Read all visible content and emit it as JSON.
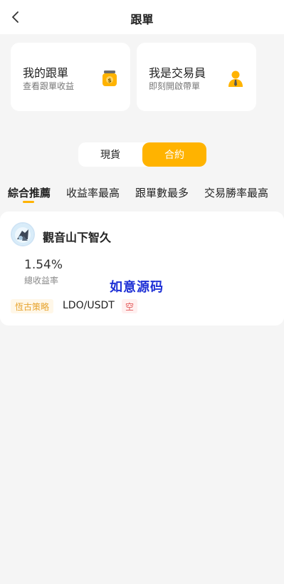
{
  "header": {
    "title": "跟單"
  },
  "cards": {
    "left": {
      "title": "我的跟單",
      "subtitle": "查看跟單收益"
    },
    "right": {
      "title": "我是交易員",
      "subtitle": "即刻開啟帶單"
    }
  },
  "segment": {
    "options": [
      "現貨",
      "合約"
    ],
    "selected": "合約"
  },
  "tabs": [
    "綜合推薦",
    "收益率最高",
    "跟單數最多",
    "交易勝率最高"
  ],
  "active_tab": "綜合推薦",
  "trader": {
    "name": "觀音山下智久",
    "yield_value": "1.54%",
    "yield_label": "總收益率",
    "strategy_tag": "恆古策略",
    "pair": "LDO/USDT",
    "direction_tag": "空"
  },
  "watermark": "如意源码",
  "colors": {
    "accent": "#ffb300",
    "background": "#f5f5f5",
    "short_red": "#e35a5a",
    "watermark_blue": "#1f31d6"
  },
  "icons": {
    "back": "chevron-left-icon",
    "my_copy": "money-bag-icon",
    "trader": "person-icon"
  }
}
